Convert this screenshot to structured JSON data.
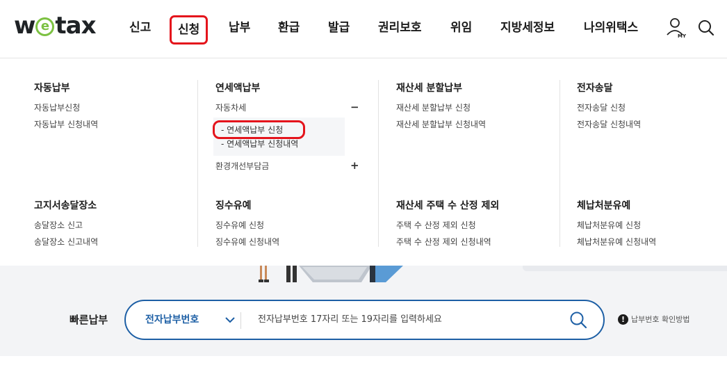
{
  "logo": {
    "pre": "w",
    "mid": "e",
    "post": "tax"
  },
  "gnb": [
    "신고",
    "신청",
    "납부",
    "환급",
    "발급",
    "권리보호",
    "위임",
    "지방세정보",
    "나의위택스"
  ],
  "header_icons": {
    "user": "user-my-icon",
    "my_label": "MY",
    "search": "search-icon"
  },
  "menu": {
    "col1": {
      "title": "자동납부",
      "items": [
        "자동납부신청",
        "자동납부 신청내역"
      ]
    },
    "col2": {
      "title": "연세액납부",
      "group1": "자동차세",
      "group1_toggle": "−",
      "group1_items": [
        "- 연세액납부 신청",
        "- 연세액납부 신청내역"
      ],
      "group2": "환경개선부담금",
      "group2_toggle": "+"
    },
    "col3": {
      "title": "재산세 분할납부",
      "items": [
        "재산세 분할납부 신청",
        "재산세 분할납부 신청내역"
      ]
    },
    "col4": {
      "title": "전자송달",
      "items": [
        "전자송달 신청",
        "전자송달 신청내역"
      ]
    },
    "col5": {
      "title": "고지서송달장소",
      "items": [
        "송달장소 신고",
        "송달장소 신고내역"
      ]
    },
    "col6": {
      "title": "징수유예",
      "items": [
        "징수유예 신청",
        "징수유예 신청내역"
      ]
    },
    "col7": {
      "title": "재산세 주택 수 산정 제외",
      "items": [
        "주택 수 산정 제외 신청",
        "주택 수 산정 제외 신청내역"
      ]
    },
    "col8": {
      "title": "체납처분유예",
      "items": [
        "체납처분유예 신청",
        "체납처분유예 신청내역"
      ]
    }
  },
  "quickpay": {
    "label": "빠른납부",
    "select_value": "전자납부번호",
    "placeholder": "전자납부번호 17자리 또는 19자리를 입력하세요",
    "help_icon": "!",
    "help_text": "납부번호 확인방법"
  },
  "colors": {
    "accent": "#1d5fa5",
    "highlight": "#e4141c",
    "logo_green": "#7cc142"
  }
}
